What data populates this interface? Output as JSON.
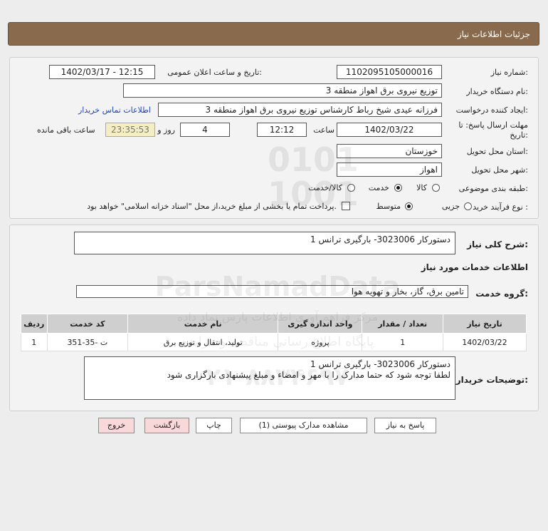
{
  "header": {
    "title": "جزئیات اطلاعات نیاز"
  },
  "form": {
    "need_number_label": "شماره نیاز:",
    "need_number": "1102095105000016",
    "announce_label": "تاریخ و ساعت اعلان عمومی:",
    "announce_value": "1402/03/17 - 12:15",
    "buyer_label": "نام دستگاه خریدار:",
    "buyer_value": "توزیع نیروی برق اهواز منطقه 3",
    "creator_label": "ایجاد کننده درخواست:",
    "creator_value": "فرزانه عیدی شیخ رباط کارشناس توزیع نیروی برق اهواز منطقه 3",
    "contact_link": "اطلاعات تماس خریدار",
    "deadline_label_1": "مهلت ارسال پاسخ: تا",
    "deadline_label_2": "تاریخ:",
    "deadline_date": "1402/03/22",
    "time_label": "ساعت",
    "deadline_time": "12:12",
    "days_value": "4",
    "days_label": "روز و",
    "remaining_time": "23:35:53",
    "remaining_label": "ساعت باقی مانده",
    "province_label": "استان محل تحویل:",
    "province_value": "خوزستان",
    "city_label": "شهر محل تحویل:",
    "city_value": "اهواز",
    "category_label": "طبقه بندی موضوعی:",
    "category_options": [
      "کالا",
      "خدمت",
      "کالا/خدمت"
    ],
    "category_selected": 1,
    "process_label": "نوع فرآیند خرید :",
    "process_options": [
      "جزیی",
      "متوسط"
    ],
    "process_selected": 1,
    "payment_note": "پرداخت تمام یا بخشی از مبلغ خرید،از محل \"اسناد خزانه اسلامی\" خواهد بود."
  },
  "details": {
    "summary_label": "شرح کلی نیاز:",
    "summary_value": "دستورکار 3023006- بارگیری ترانس 1",
    "services_title": "اطلاعات خدمات مورد نیاز",
    "group_label": "گروه خدمت:",
    "group_value": "تامین برق، گاز، بخار و تهویه هوا",
    "table": {
      "headers": [
        "ردیف",
        "کد خدمت",
        "نام خدمت",
        "واحد اندازه گیری",
        "تعداد / مقدار",
        "تاریخ نیاز"
      ],
      "rows": [
        [
          "1",
          "ت -35-351",
          "تولید، انتقال و توزیع برق",
          "پروژه",
          "1",
          "1402/03/22"
        ]
      ]
    },
    "buyer_desc_label": "توضیحات خریدار:",
    "buyer_desc_line1": "دستورکار 3023006- بارگیری ترانس 1",
    "buyer_desc_line2": "لطفا توجه شود که حتما مدارک را با مهر و امضاء و مبلغ پیشنهادی بارگزاری شود"
  },
  "buttons": {
    "reply": "پاسخ به نیاز",
    "view_docs": "مشاهده مدارک پیوستی (1)",
    "print": "چاپ",
    "back": "بازگشت",
    "exit": "خروج"
  },
  "watermark": {
    "line1": "0101",
    "line2": "1001",
    "brand": "ParsNamadData",
    "caption1": "مرکز فراهم آوری اطلاعات پارس نماد داده",
    "caption2": "پایگاه اطلاع رسانی مناقصه و مزایده",
    "phone": "۰۲۱-۸۸۳۴۶۹۷۰"
  },
  "colors": {
    "header_bg": "#8a6a4c",
    "link": "#1f45b5",
    "timer_bg": "#f4eec2",
    "pink_button": "#f8d8d8"
  }
}
